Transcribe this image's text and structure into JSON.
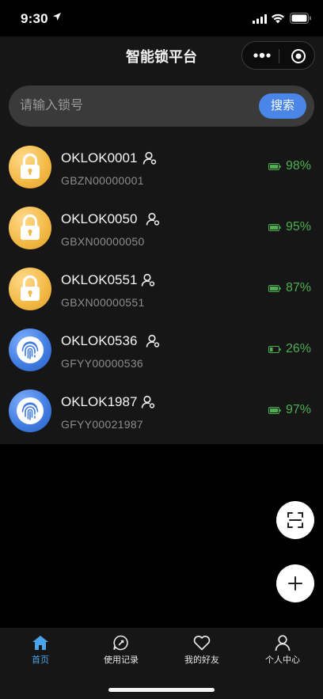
{
  "status_bar": {
    "time": "9:30"
  },
  "nav": {
    "title": "智能锁平台"
  },
  "search": {
    "placeholder": "请输入锁号",
    "button_label": "搜索"
  },
  "locks": [
    {
      "name": "OKLOK0001",
      "serial": "GBZN00000001",
      "battery": "98%",
      "type": "padlock"
    },
    {
      "name": "OKLOK0050",
      "serial": "GBXN00000050",
      "battery": "95%",
      "type": "padlock"
    },
    {
      "name": "OKLOK0551",
      "serial": "GBXN00000551",
      "battery": "87%",
      "type": "padlock"
    },
    {
      "name": "OKLOK0536",
      "serial": "GFYY00000536",
      "battery": "26%",
      "type": "fingerprint"
    },
    {
      "name": "OKLOK1987",
      "serial": "GFYY00021987",
      "battery": "97%",
      "type": "fingerprint"
    }
  ],
  "tabs": [
    {
      "label": "首页",
      "icon": "home-icon",
      "active": true
    },
    {
      "label": "使用记录",
      "icon": "record-icon",
      "active": false
    },
    {
      "label": "我的好友",
      "icon": "heart-icon",
      "active": false
    },
    {
      "label": "个人中心",
      "icon": "person-icon",
      "active": false
    }
  ],
  "colors": {
    "accent": "#4a86e8",
    "battery_green": "#4caf50",
    "tab_active": "#4aa3e8",
    "padlock_gold": "#f2b843",
    "fingerprint_blue": "#3e7ae0"
  }
}
